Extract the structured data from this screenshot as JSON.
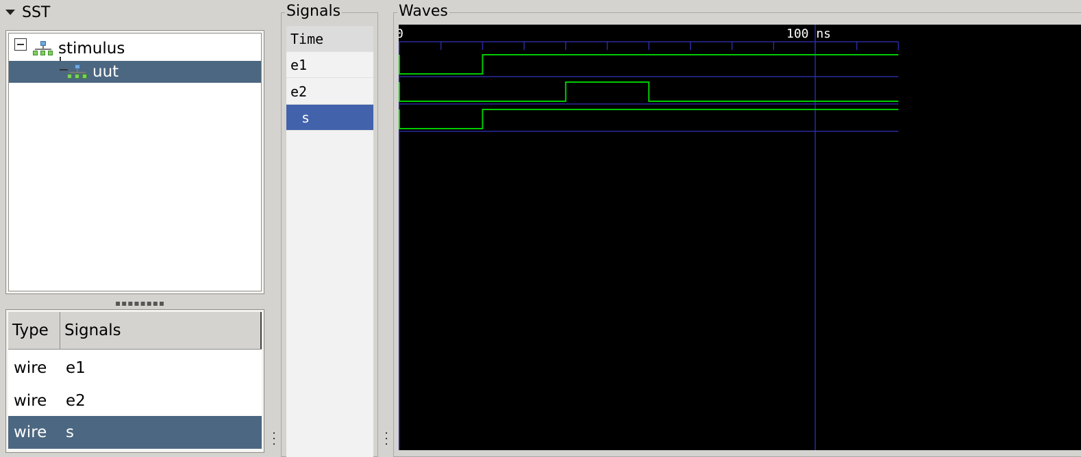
{
  "sst": {
    "title": "SST",
    "tree": [
      {
        "label": "stimulus",
        "selected": false
      },
      {
        "label": "uut",
        "selected": true
      }
    ],
    "list_headers": {
      "type": "Type",
      "signals": "Signals"
    },
    "list_rows": [
      {
        "type": "wire",
        "name": "e1",
        "selected": false
      },
      {
        "type": "wire",
        "name": "e2",
        "selected": false
      },
      {
        "type": "wire",
        "name": "s",
        "selected": true
      }
    ]
  },
  "signals": {
    "title": "Signals",
    "time_label": "Time",
    "rows": [
      {
        "name": "e1",
        "selected": false
      },
      {
        "name": "e2",
        "selected": false
      },
      {
        "name": "s",
        "selected": true
      }
    ]
  },
  "waves": {
    "title": "Waves",
    "time_start_label": "0",
    "time_marker_label": "100 ns",
    "time_unit": "ns",
    "time_start": 0,
    "time_end": 120,
    "marker_time": 100,
    "tick_step": 10,
    "signals": [
      {
        "name": "e1",
        "transitions": [
          [
            0,
            0
          ],
          [
            20,
            1
          ]
        ]
      },
      {
        "name": "e2",
        "transitions": [
          [
            0,
            0
          ],
          [
            40,
            1
          ],
          [
            60,
            0
          ]
        ]
      },
      {
        "name": "s",
        "transitions": [
          [
            0,
            0
          ],
          [
            20,
            1
          ]
        ]
      }
    ],
    "colors": {
      "background": "#000000",
      "wave": "#00cc00",
      "grid": "#2a2aa0",
      "marker": "#2a2aa0"
    }
  }
}
